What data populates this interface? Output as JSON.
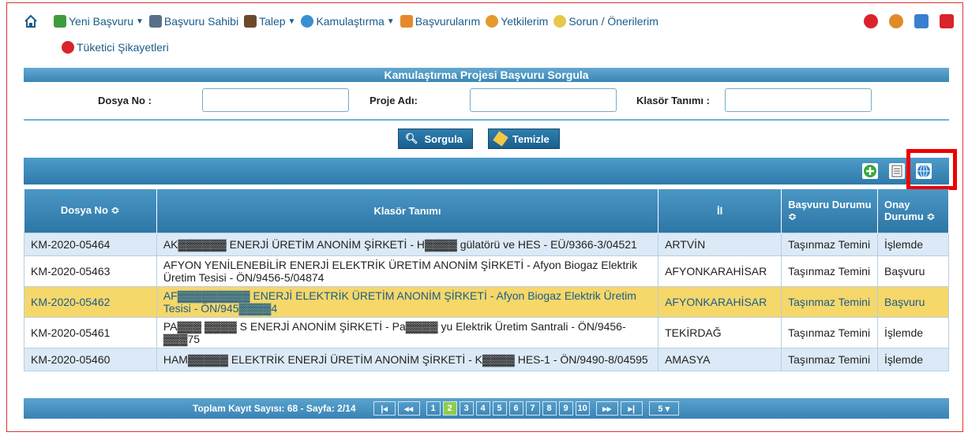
{
  "nav": {
    "items": [
      {
        "label": "Yeni Başvuru",
        "has_caret": true
      },
      {
        "label": "Başvuru Sahibi",
        "has_caret": false
      },
      {
        "label": "Talep",
        "has_caret": true
      },
      {
        "label": "Kamulaştırma",
        "has_caret": true
      },
      {
        "label": "Başvurularım",
        "has_caret": false
      },
      {
        "label": "Yetkilerim",
        "has_caret": false
      },
      {
        "label": "Sorun / Önerilerim",
        "has_caret": false
      }
    ],
    "second_row": "Tüketici Şikayetleri"
  },
  "search": {
    "title": "Kamulaştırma Projesi Başvuru Sorgula",
    "dosya_no_label": "Dosya No :",
    "proje_adi_label": "Proje Adı:",
    "klasor_label": "Klasör Tanımı :",
    "sorgula_label": "Sorgula",
    "temizle_label": "Temizle"
  },
  "table": {
    "headers": [
      "Dosya No ≎",
      "Klasör Tanımı",
      "İl",
      "Başvuru Durumu ≎",
      "Onay Durumu ≎"
    ],
    "rows": [
      {
        "dosya": "KM-2020-05464",
        "klasor": "AK▓▓▓▓▓▓ ENERJİ ÜRETİM ANONİM ŞİRKETİ - H▓▓▓▓ gülatörü ve HES - EÜ/9366-3/04521",
        "il": "ARTVİN",
        "basvuru": "Taşınmaz Temini",
        "onay": "İşlemde"
      },
      {
        "dosya": "KM-2020-05463",
        "klasor": "AFYON YENİLENEBİLİR ENERJİ ELEKTRİK ÜRETİM ANONİM ŞİRKETİ - Afyon Biogaz Elektrik Üretim Tesisi - ÖN/9456-5/04874",
        "il": "AFYONKARAHİSAR",
        "basvuru": "Taşınmaz Temini",
        "onay": "Başvuru"
      },
      {
        "dosya": "KM-2020-05462",
        "klasor": "AF▓▓▓▓▓▓▓▓▓ ENERJİ ELEKTRİK ÜRETİM ANONİM ŞİRKETİ - Afyon Biogaz Elektrik Üretim Tesisi - ÖN/945▓▓▓▓4",
        "il": "AFYONKARAHİSAR",
        "basvuru": "Taşınmaz Temini",
        "onay": "Başvuru"
      },
      {
        "dosya": "KM-2020-05461",
        "klasor": "PA▓▓▓ ▓▓▓▓ S ENERJİ ANONİM ŞİRKETİ - Pa▓▓▓▓ yu Elektrik Üretim Santrali - ÖN/9456-▓▓▓75",
        "il": "TEKİRDAĞ",
        "basvuru": "Taşınmaz Temini",
        "onay": "İşlemde"
      },
      {
        "dosya": "KM-2020-05460",
        "klasor": "HAM▓▓▓▓▓ ELEKTRİK ENERJİ ÜRETİM ANONİM ŞİRKETİ - K▓▓▓▓ HES-1 - ÖN/9490-8/04595",
        "il": "AMASYA",
        "basvuru": "Taşınmaz Temini",
        "onay": "İşlemde"
      }
    ]
  },
  "pager": {
    "summary": "Toplam Kayıt Sayısı: 68 - Sayfa: 2/14",
    "first": "|◂",
    "prev": "◂◂",
    "pages": [
      "1",
      "2",
      "3",
      "4",
      "5",
      "6",
      "7",
      "8",
      "9",
      "10"
    ],
    "active_page": "2",
    "next": "▸▸",
    "last": "▸|",
    "page_size": "5 ▾"
  },
  "colors": {
    "accent": "#2d76a6",
    "selected_row": "#f6d76a",
    "highlight_box": "#ee0000"
  }
}
